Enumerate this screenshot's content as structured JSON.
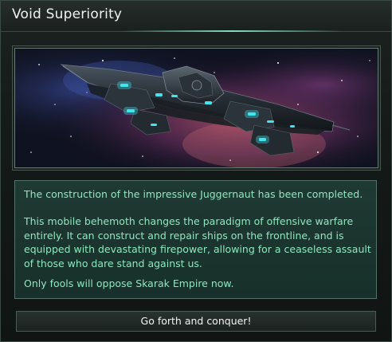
{
  "dialog": {
    "title": "Void Superiority",
    "image_alt": "juggernaut-ship-illustration",
    "message": {
      "paragraph_1": "The construction of the impressive Juggernaut has been completed.",
      "paragraph_2": "This mobile behemoth changes the paradigm of offensive warfare entirely. It can construct and repair ships on the frontline, and is equipped with devastating firepower, allowing for a ceaseless assault of those who dare stand against us.",
      "paragraph_3": "Only fools will oppose Skarak Empire now."
    },
    "confirm_label": "Go forth and conquer!"
  },
  "colors": {
    "message_text": "#8ee6c0",
    "panel_bg": "#1f3a33",
    "accent_glow": "#8cf0d2",
    "ship_lights": "#3fe6f0"
  }
}
